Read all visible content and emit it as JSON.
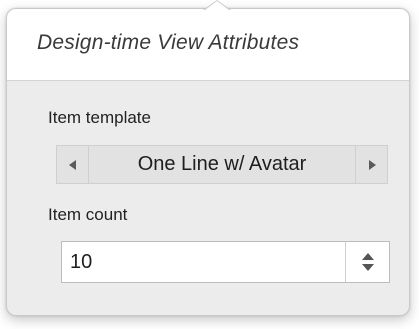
{
  "header": {
    "title": "Design-time View Attributes"
  },
  "item_template": {
    "label": "Item template",
    "value": "One Line w/ Avatar",
    "prev_icon": "triangle-left-icon",
    "next_icon": "triangle-right-icon"
  },
  "item_count": {
    "label": "Item count",
    "value": "10",
    "stepper_icon": "up-down-stepper-icon"
  }
}
